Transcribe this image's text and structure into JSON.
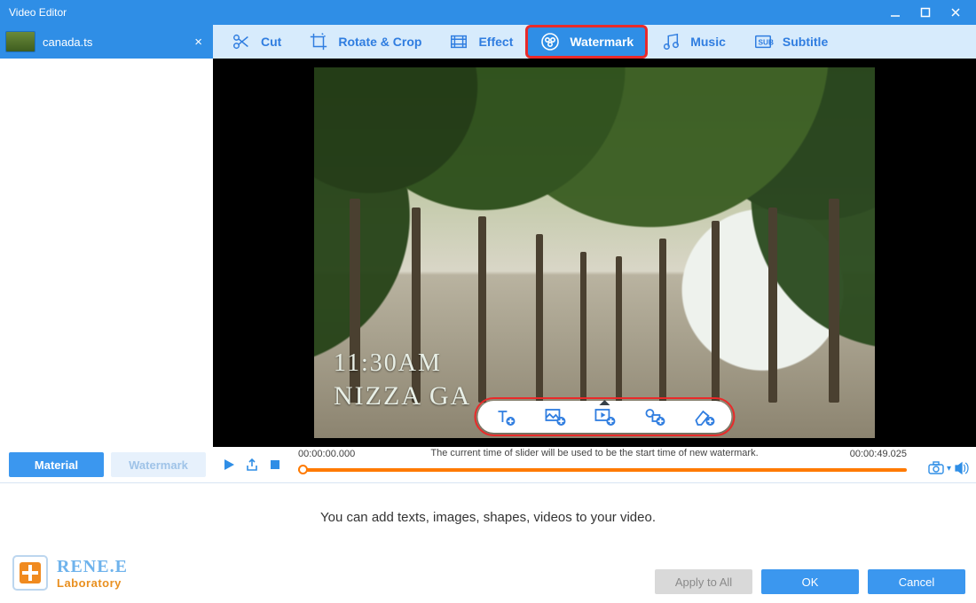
{
  "window": {
    "title": "Video Editor"
  },
  "file": {
    "name": "canada.ts"
  },
  "side_tabs": {
    "material": "Material",
    "watermark": "Watermark"
  },
  "toolbar": {
    "cut": "Cut",
    "rotate": "Rotate & Crop",
    "effect": "Effect",
    "watermark": "Watermark",
    "music": "Music",
    "subtitle": "Subtitle"
  },
  "preview_overlay": {
    "line1": "11:30AM",
    "line2": "NIZZA GA"
  },
  "timeline": {
    "start": "00:00:00.000",
    "end": "00:00:49.025",
    "hint": "The current time of slider will be used to be the start time of new watermark."
  },
  "bottom": {
    "message": "You can add texts, images, shapes, videos to your video.",
    "apply_all": "Apply to All",
    "ok": "OK",
    "cancel": "Cancel"
  },
  "brand": {
    "top": "RENE.E",
    "bottom": "Laboratory"
  }
}
